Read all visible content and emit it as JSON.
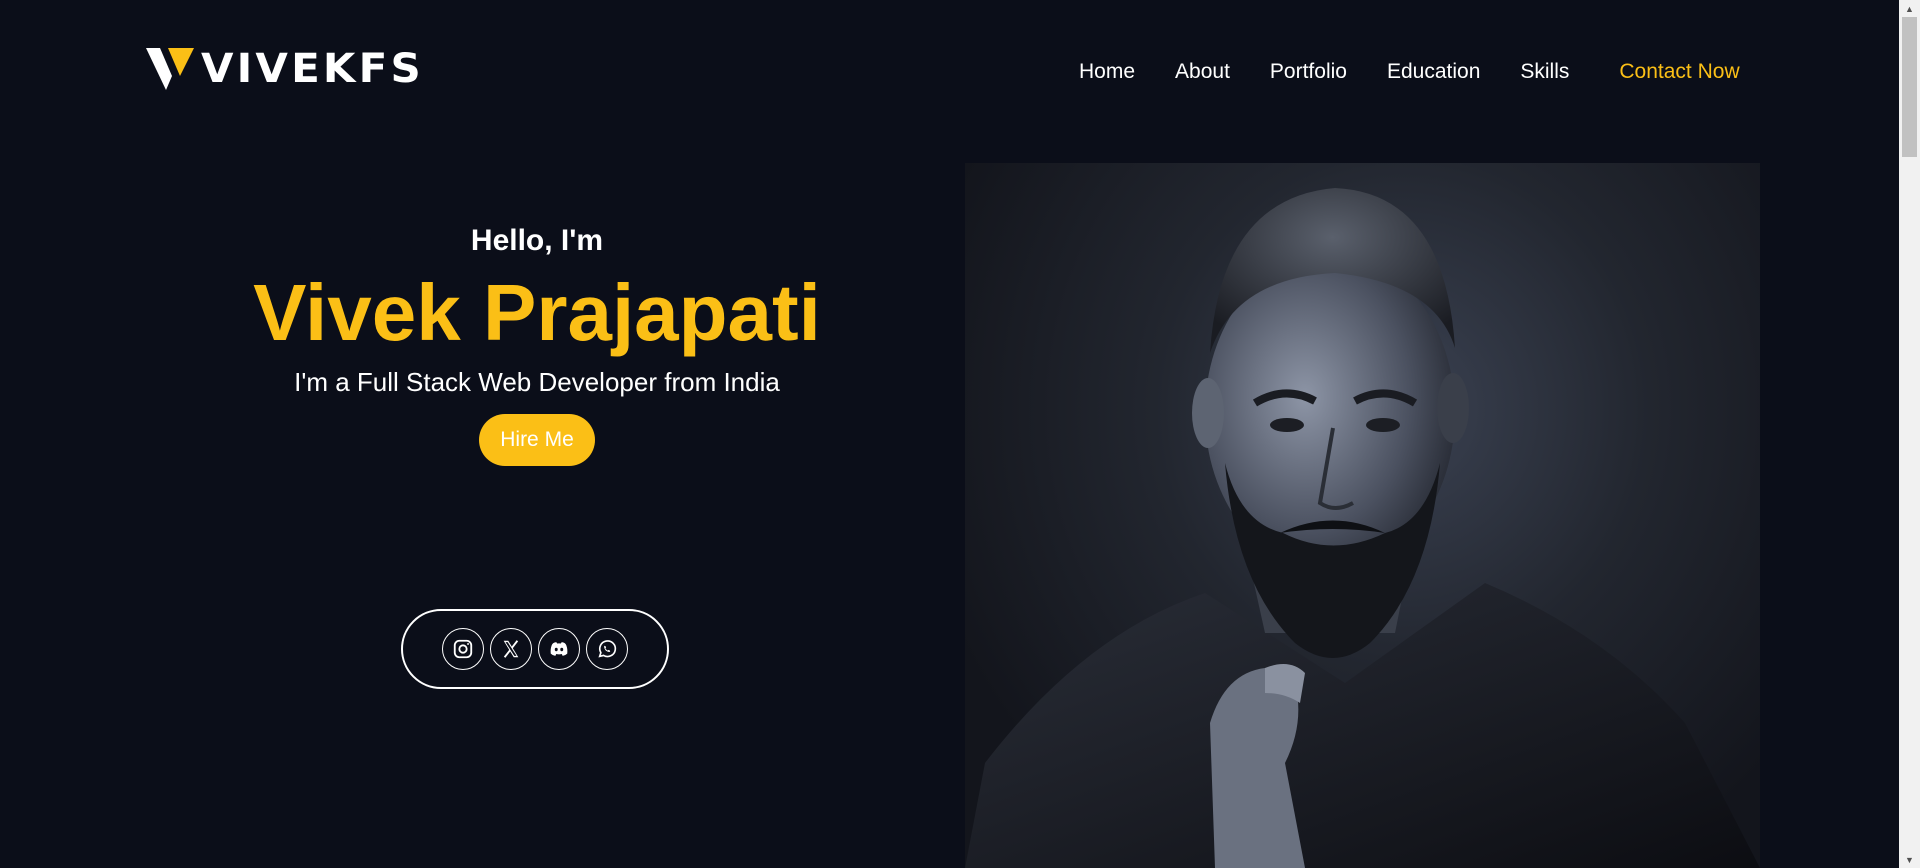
{
  "header": {
    "logo_text": "VIVEKFS",
    "nav": [
      "Home",
      "About",
      "Portfolio",
      "Education",
      "Skills"
    ],
    "contact_label": "Contact Now"
  },
  "hero": {
    "greeting": "Hello, I'm",
    "name": "Vivek Prajapati",
    "tagline": "I'm a Full Stack Web Developer from India",
    "hire_label": "Hire Me"
  },
  "social": [
    "instagram-icon",
    "x-twitter-icon",
    "discord-icon",
    "whatsapp-icon"
  ],
  "colors": {
    "background": "#0b0e19",
    "accent": "#fbbf16",
    "text": "#ffffff"
  }
}
